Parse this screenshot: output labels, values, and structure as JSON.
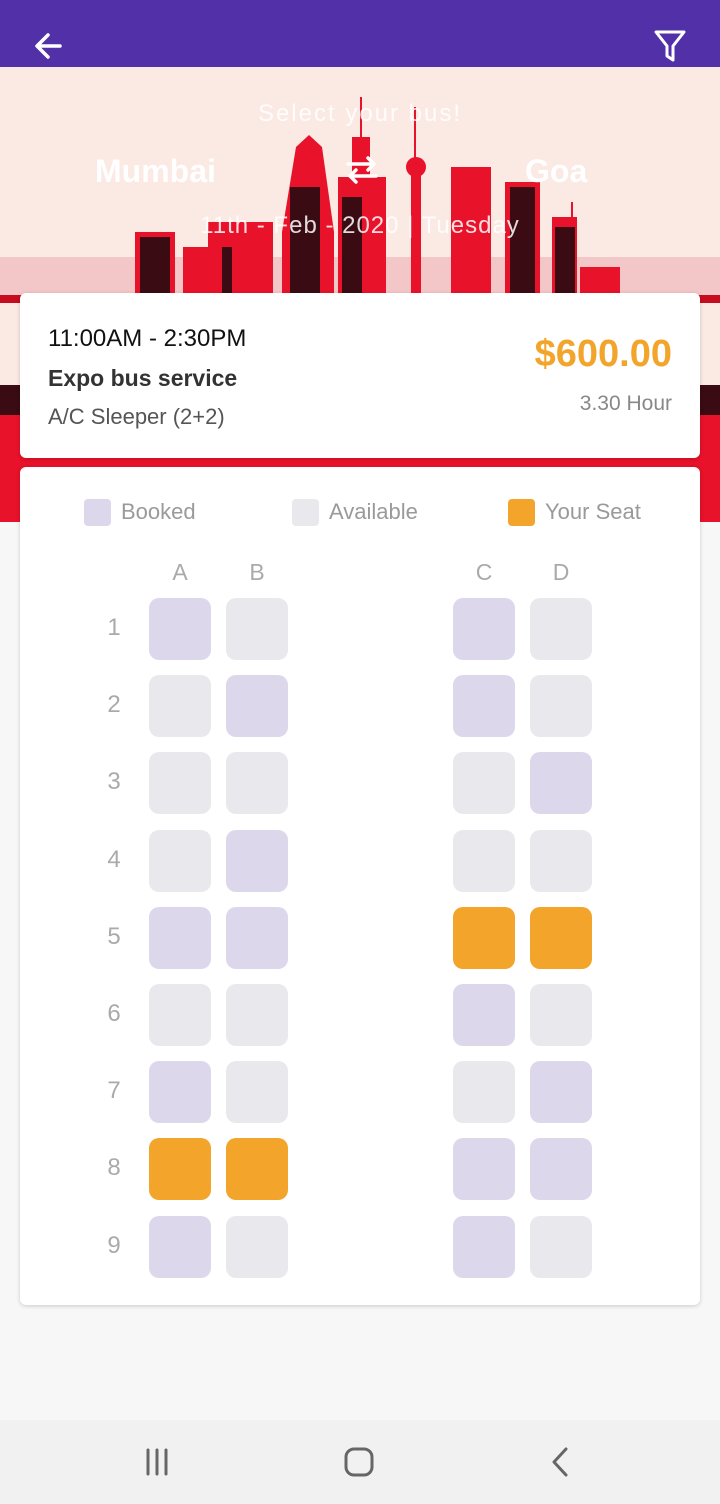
{
  "topbar": {
    "back_icon": "arrow-left-icon",
    "filter_icon": "filter-icon",
    "color": "#5230a8"
  },
  "hero": {
    "subtitle": "Select your bus!",
    "from": "Mumbai",
    "to": "Goa",
    "swap_icon": "swap-arrows-icon",
    "date": "11th - Feb - 2020 | Tuesday"
  },
  "bus": {
    "time": "11:00AM - 2:30PM",
    "operator": "Expo bus service",
    "type": "A/C Sleeper (2+2)",
    "price": "$600.00",
    "duration": "3.30 Hour"
  },
  "legend": {
    "booked": "Booked",
    "available": "Available",
    "your_seat": "Your Seat"
  },
  "colors": {
    "booked": "#ddd7ec",
    "available": "#e9e9ed",
    "your_seat": "#f2a52a"
  },
  "columns": [
    "A",
    "B",
    "C",
    "D"
  ],
  "rows": [
    {
      "label": "1",
      "seats": [
        "booked",
        "available",
        "booked",
        "available"
      ]
    },
    {
      "label": "2",
      "seats": [
        "available",
        "booked",
        "booked",
        "available"
      ]
    },
    {
      "label": "3",
      "seats": [
        "available",
        "available",
        "available",
        "booked"
      ]
    },
    {
      "label": "4",
      "seats": [
        "available",
        "booked",
        "available",
        "available"
      ]
    },
    {
      "label": "5",
      "seats": [
        "booked",
        "booked",
        "mine",
        "mine"
      ]
    },
    {
      "label": "6",
      "seats": [
        "available",
        "available",
        "booked",
        "available"
      ]
    },
    {
      "label": "7",
      "seats": [
        "booked",
        "available",
        "available",
        "booked"
      ]
    },
    {
      "label": "8",
      "seats": [
        "mine",
        "mine",
        "booked",
        "booked"
      ]
    },
    {
      "label": "9",
      "seats": [
        "booked",
        "available",
        "booked",
        "available"
      ]
    }
  ],
  "navbar": {
    "recent_icon": "recent-apps-icon",
    "home_icon": "home-icon",
    "back_icon": "nav-back-icon"
  }
}
